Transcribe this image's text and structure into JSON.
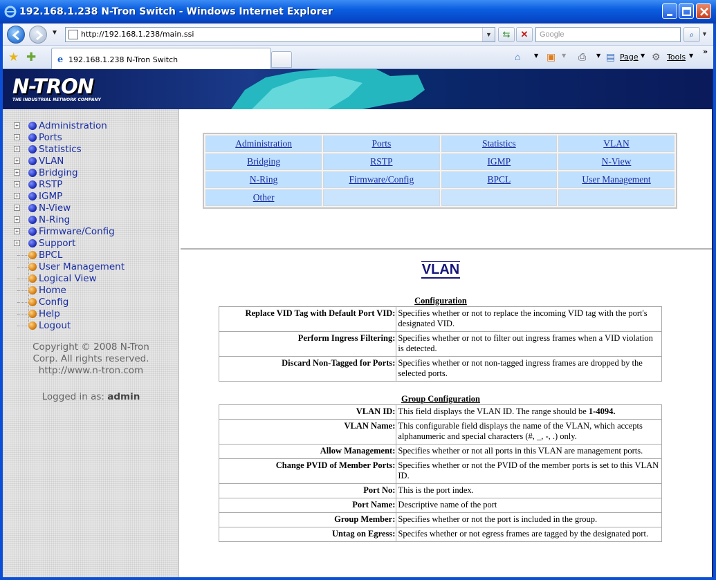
{
  "window": {
    "title": "192.168.1.238 N-Tron Switch - Windows Internet Explorer"
  },
  "browser": {
    "url": "http://192.168.1.238/main.ssi",
    "search_placeholder": "Google",
    "tab_label": "192.168.1.238 N-Tron Switch",
    "page_menu": "Page",
    "tools_menu": "Tools"
  },
  "banner": {
    "logo_text": "N-TRON",
    "logo_tagline": "THE INDUSTRIAL NETWORK COMPANY"
  },
  "sidebar": {
    "tree": [
      {
        "label": "Administration",
        "kind": "folder"
      },
      {
        "label": "Ports",
        "kind": "folder"
      },
      {
        "label": "Statistics",
        "kind": "folder"
      },
      {
        "label": "VLAN",
        "kind": "folder"
      },
      {
        "label": "Bridging",
        "kind": "folder"
      },
      {
        "label": "RSTP",
        "kind": "folder"
      },
      {
        "label": "IGMP",
        "kind": "folder"
      },
      {
        "label": "N-View",
        "kind": "folder"
      },
      {
        "label": "N-Ring",
        "kind": "folder"
      },
      {
        "label": "Firmware/Config",
        "kind": "folder"
      },
      {
        "label": "Support",
        "kind": "folder"
      },
      {
        "label": "BPCL",
        "kind": "leaf"
      },
      {
        "label": "User Management",
        "kind": "leaf"
      },
      {
        "label": "Logical View",
        "kind": "leaf"
      },
      {
        "label": "Home",
        "kind": "leaf"
      },
      {
        "label": "Config",
        "kind": "leaf"
      },
      {
        "label": "Help",
        "kind": "leaf"
      },
      {
        "label": "Logout",
        "kind": "leaf"
      }
    ],
    "copyright_line1": "Copyright © 2008 N-Tron",
    "copyright_line2": "Corp. All rights reserved.",
    "copyright_line3": "http://www.n-tron.com",
    "logged_in_prefix": "Logged in as:",
    "logged_in_user": "admin"
  },
  "menu": {
    "rows": [
      [
        "Administration",
        "Ports",
        "Statistics",
        "VLAN"
      ],
      [
        "Bridging",
        "RSTP",
        "IGMP",
        "N-View"
      ],
      [
        "N-Ring",
        "Firmware/Config",
        "BPCL",
        "User Management"
      ],
      [
        "Other",
        "",
        "",
        ""
      ]
    ]
  },
  "doc": {
    "title": "VLAN",
    "config_caption": "Configuration",
    "config_rows": [
      {
        "key": "Replace VID Tag with Default Port VID:",
        "desc": "Specifies whether or not to replace the incoming VID tag with the port's designated VID."
      },
      {
        "key": "Perform Ingress Filtering:",
        "desc": "Specifies whether or not to filter out ingress frames when a VID violation is detected."
      },
      {
        "key": "Discard Non-Tagged for Ports:",
        "desc": "Specifies whether or not non-tagged ingress frames are dropped by the selected ports."
      }
    ],
    "group_caption": "Group Configuration",
    "group_rows": [
      {
        "key": "VLAN ID:",
        "desc": "This field displays the VLAN ID. The range should be ",
        "desc_bold": "1-4094."
      },
      {
        "key": "VLAN Name:",
        "desc": "This configurable field displays the name of the VLAN, which accepts alphanumeric and special characters (#, _, -, .) only."
      },
      {
        "key": "Allow Management:",
        "desc": "Specifies whether or not all ports in this VLAN are management ports."
      },
      {
        "key": "Change PVID of Member Ports:",
        "desc": "Specifies whether or not the PVID of the member ports is set to this VLAN ID."
      },
      {
        "key": "Port No:",
        "desc": "This is the port index."
      },
      {
        "key": "Port Name:",
        "desc": "Descriptive name of the port"
      },
      {
        "key": "Group Member:",
        "desc": "Specifies whether or not the port is included in the group."
      },
      {
        "key": "Untag on Egress:",
        "desc": "Specifes whether or not egress frames are tagged by the designated port."
      }
    ]
  }
}
